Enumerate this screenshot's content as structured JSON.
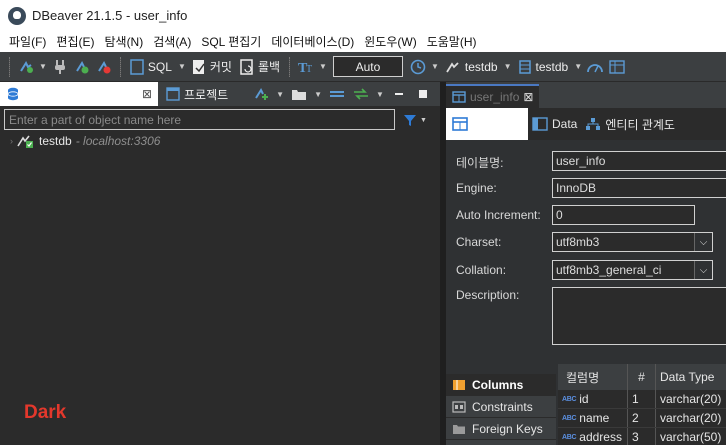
{
  "window": {
    "title": "DBeaver 21.1.5 - user_info"
  },
  "menu": [
    "파일(F)",
    "편집(E)",
    "탐색(N)",
    "검색(A)",
    "SQL 편집기",
    "데이터베이스(D)",
    "윈도우(W)",
    "도움말(H)"
  ],
  "toolbar": {
    "sql_label": "SQL",
    "commit_label": "커밋",
    "rollback_label": "롤백",
    "transaction_mode": "Auto",
    "active_connection": "testdb",
    "active_database": "testdb"
  },
  "navigator": {
    "projects_tab": "프로젝트",
    "filter_placeholder": "Enter a part of object name here",
    "connection": {
      "name": "testdb",
      "host": " - localhost:3306"
    }
  },
  "overlay_label": "Dark",
  "editor": {
    "tab_title": "user_info",
    "subtabs": {
      "data": "Data",
      "er": "엔티티 관계도"
    },
    "props": {
      "table_name_label": "테이블명:",
      "table_name": "user_info",
      "engine_label": "Engine:",
      "engine": "InnoDB",
      "auto_inc_label": "Auto Increment:",
      "auto_inc": "0",
      "charset_label": "Charset:",
      "charset": "utf8mb3",
      "collation_label": "Collation:",
      "collation": "utf8mb3_general_ci",
      "description_label": "Description:",
      "description": ""
    },
    "nav": [
      "Columns",
      "Constraints",
      "Foreign Keys"
    ],
    "columns": {
      "headers": [
        "컬럼명",
        "#",
        "Data Type"
      ],
      "rows": [
        {
          "name": "id",
          "num": "1",
          "type": "varchar(20)"
        },
        {
          "name": "name",
          "num": "2",
          "type": "varchar(20)"
        },
        {
          "name": "address",
          "num": "3",
          "type": "varchar(50)"
        }
      ]
    }
  },
  "colors": {
    "accent_blue": "#4a78c2",
    "dark_label": "#e3382c"
  }
}
